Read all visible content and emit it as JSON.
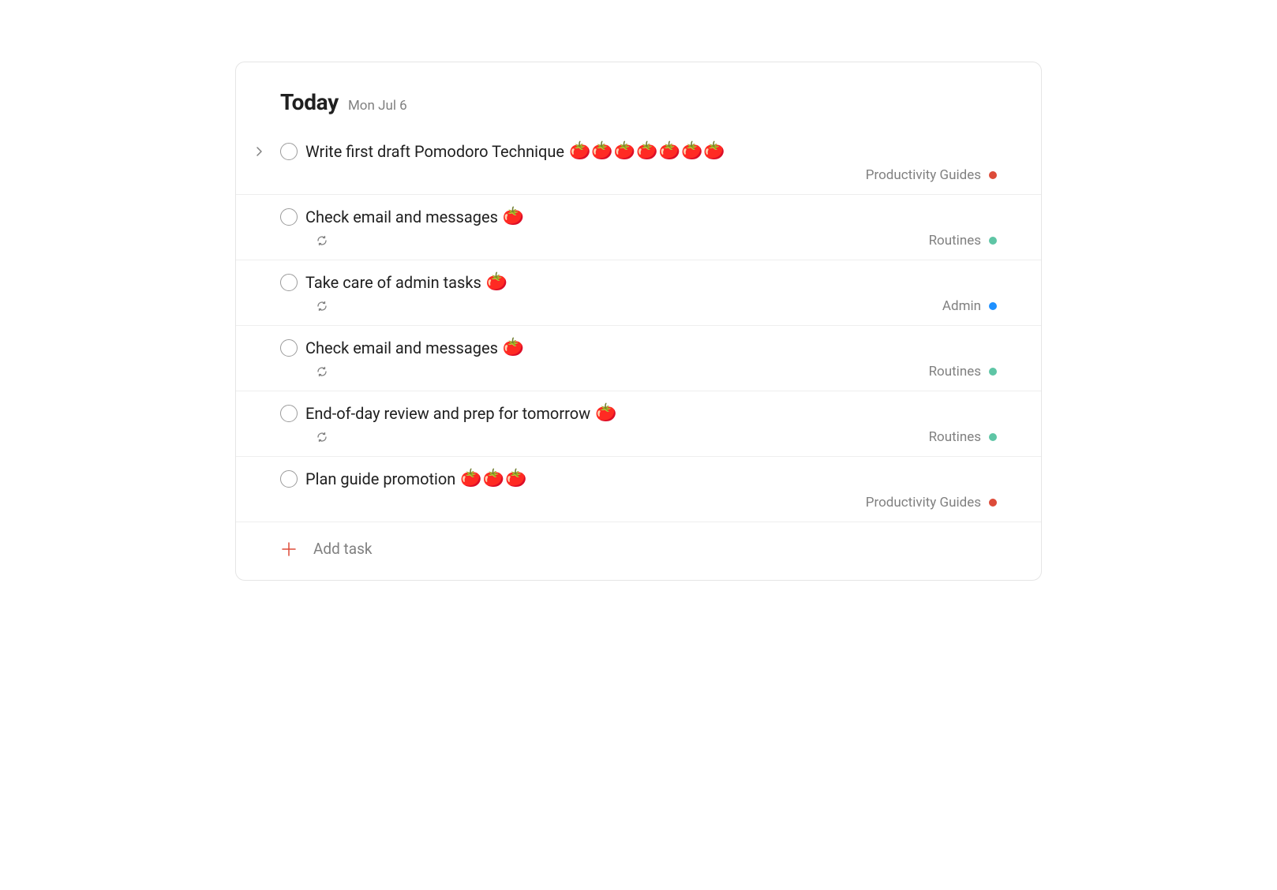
{
  "header": {
    "title": "Today",
    "date": "Mon Jul 6"
  },
  "addTask": {
    "label": "Add task"
  },
  "projectColors": {
    "Productivity Guides": "#dd4b39",
    "Routines": "#5ec5a5",
    "Admin": "#1e90ff"
  },
  "tasks": [
    {
      "title": "Write first draft Pomodoro Technique",
      "tomatoCount": 7,
      "recurring": false,
      "hasSubtasks": true,
      "project": "Productivity Guides"
    },
    {
      "title": "Check email and messages",
      "tomatoCount": 1,
      "recurring": true,
      "hasSubtasks": false,
      "project": "Routines"
    },
    {
      "title": "Take care of admin tasks",
      "tomatoCount": 1,
      "recurring": true,
      "hasSubtasks": false,
      "project": "Admin"
    },
    {
      "title": "Check email and messages",
      "tomatoCount": 1,
      "recurring": true,
      "hasSubtasks": false,
      "project": "Routines"
    },
    {
      "title": "End-of-day review and prep for tomorrow",
      "tomatoCount": 1,
      "recurring": true,
      "hasSubtasks": false,
      "project": "Routines"
    },
    {
      "title": "Plan guide promotion",
      "tomatoCount": 3,
      "recurring": false,
      "hasSubtasks": false,
      "project": "Productivity Guides"
    }
  ]
}
